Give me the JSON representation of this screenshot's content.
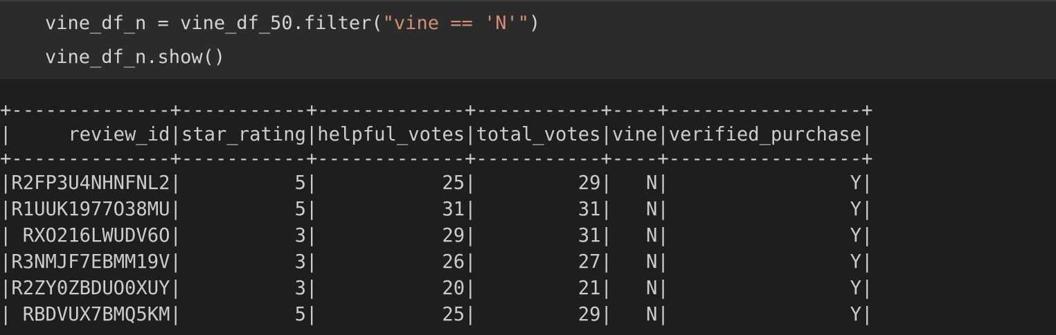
{
  "code": {
    "line1_prefix": "vine_df_n = vine_df_50.filter(",
    "line1_string": "\"vine == 'N'\"",
    "line1_suffix": ")",
    "line2": "vine_df_n.show()"
  },
  "output": {
    "border": "+--------------+-----------+-------------+-----------+----+-----------------+",
    "header": "|     review_id|star_rating|helpful_votes|total_votes|vine|verified_purchase|",
    "rows": [
      "|R2FP3U4NHNFNL2|          5|           25|         29|   N|                Y|",
      "|R1UUK1977O38MU|          5|           31|         31|   N|                Y|",
      "| RXO216LWUDV6O|          3|           29|         31|   N|                Y|",
      "|R3NMJF7EBMM19V|          3|           26|         27|   N|                Y|",
      "|R2ZY0ZBDUO0XUY|          3|           20|         21|   N|                Y|",
      "| RBDVUX7BMQ5KM|          5|           25|         29|   N|                Y|"
    ]
  },
  "colors": {
    "background": "#1e1e1e",
    "input_background": "#2b2b2b",
    "code_text": "#d4d4d4",
    "string_literal": "#ce9178",
    "output_text": "#cccccc"
  }
}
